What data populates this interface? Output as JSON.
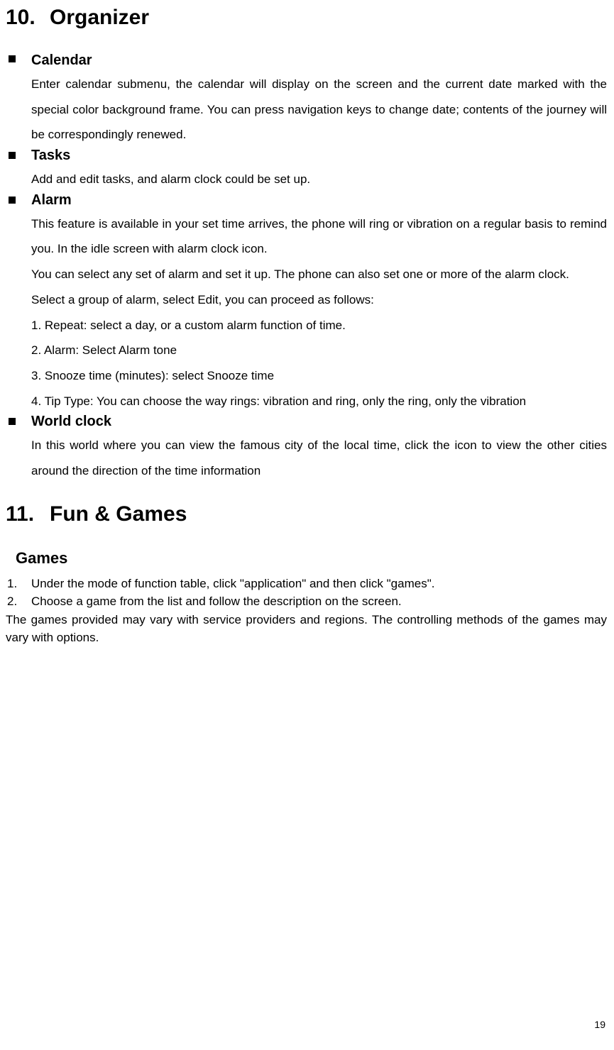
{
  "section10": {
    "number": "10.",
    "title": "Organizer",
    "items": {
      "calendar": {
        "heading": "Calendar",
        "body": "Enter calendar submenu, the calendar will display on the screen and the current date marked with the special color background frame. You can press navigation keys to change date; contents of the journey will be correspondingly renewed."
      },
      "tasks": {
        "heading": "Tasks",
        "body": "Add and edit tasks, and alarm clock could be set up."
      },
      "alarm": {
        "heading": "Alarm",
        "p1": " This feature is available in your set time arrives, the phone will ring or vibration on a regular basis to remind you. In the idle screen with alarm clock icon.",
        "p2": "You can select any set of alarm and set it up. The phone can also set one or more of the alarm clock.",
        "p3": "Select a group of alarm, select Edit, you can proceed as follows:",
        "l1": "1. Repeat: select a day, or a custom alarm function of time.",
        "l2": "2. Alarm: Select Alarm tone",
        "l3": "3. Snooze time (minutes): select Snooze time",
        "l4": "4. Tip Type: You can choose the way rings: vibration and ring, only the ring, only the vibration"
      },
      "worldclock": {
        "heading": "World clock",
        "body": "In this world where you can view the famous city of the local time, click the icon to view the other cities around the direction of the time information"
      }
    }
  },
  "section11": {
    "number": "11.",
    "title": "Fun & Games",
    "games": {
      "heading": "Games",
      "item1_num": "1.",
      "item1_text": "Under the mode of function table, click \"application\" and then click \"games\".",
      "item2_num": "2.",
      "item2_text": "Choose a game from the list and follow the description on the screen.",
      "footer": "The games provided may vary with service providers and regions. The controlling methods of the games may vary with options."
    }
  },
  "pageNumber": "19"
}
